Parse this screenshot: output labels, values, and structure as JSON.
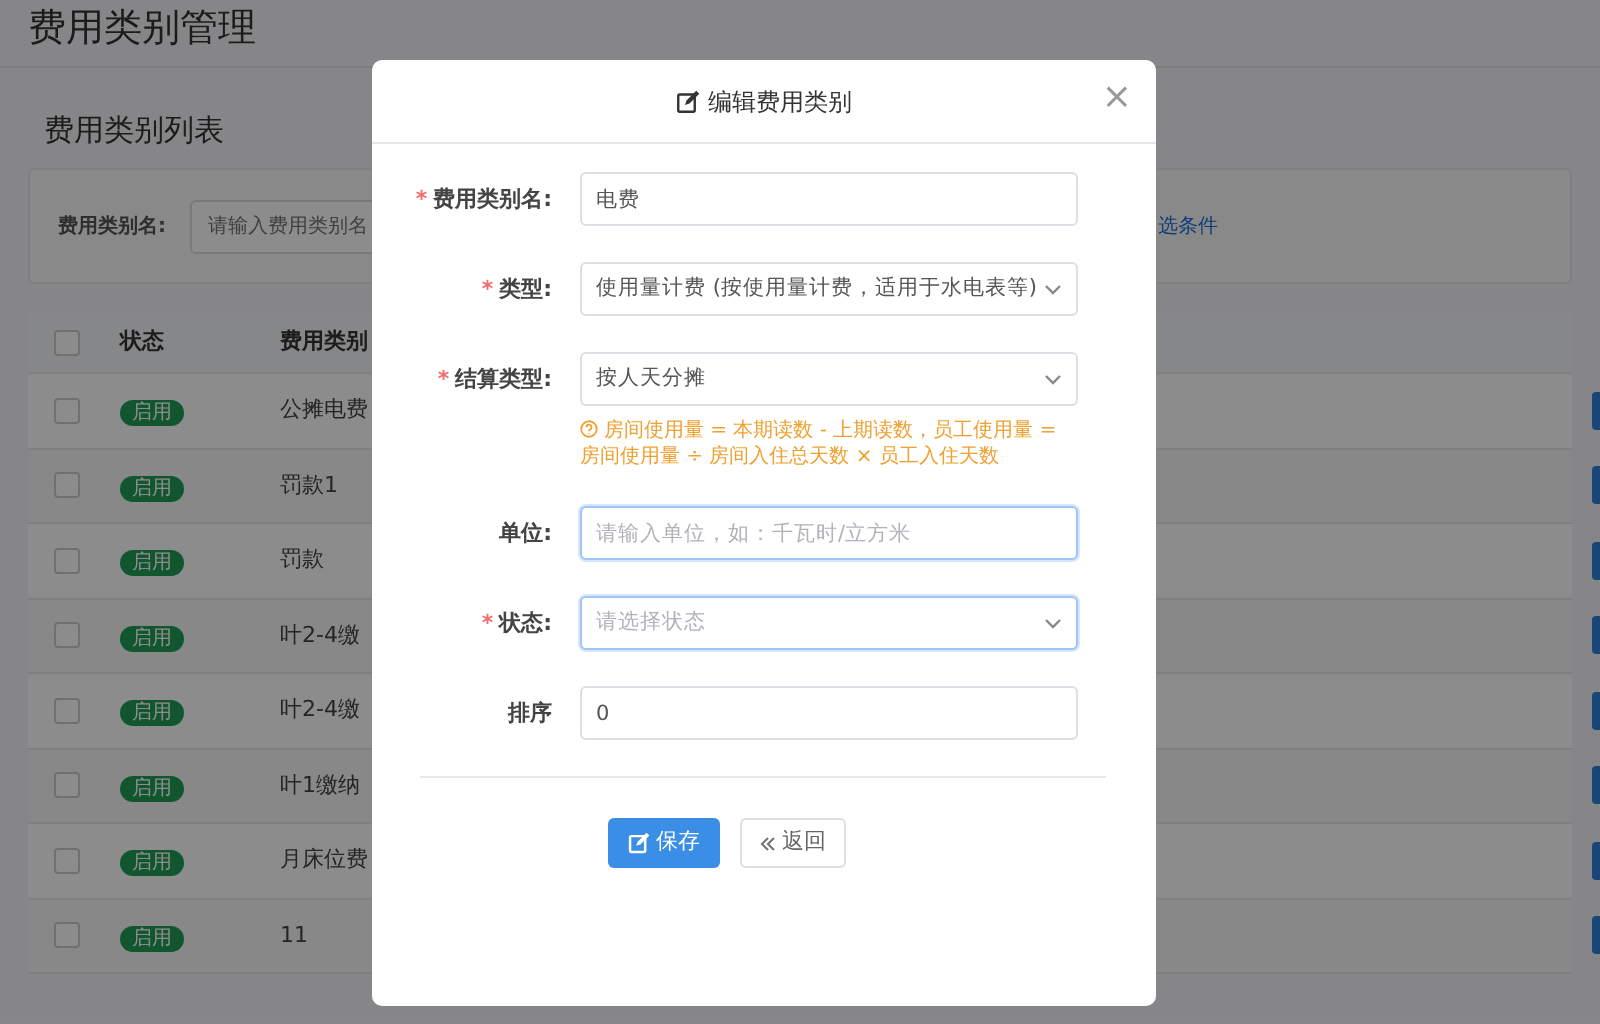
{
  "page": {
    "title": "费用类别管理",
    "section_title": "费用类别列表"
  },
  "filter": {
    "label": "费用类别名:",
    "placeholder": "请输入费用类别名",
    "link": "选条件"
  },
  "table": {
    "columns": [
      "状态",
      "费用类别"
    ],
    "select_all_checked": false,
    "rows": [
      {
        "checked": false,
        "status": "启用",
        "name": "公摊电费"
      },
      {
        "checked": false,
        "status": "启用",
        "name": "罚款1"
      },
      {
        "checked": false,
        "status": "启用",
        "name": "罚款"
      },
      {
        "checked": false,
        "status": "启用",
        "name": "叶2-4缴"
      },
      {
        "checked": false,
        "status": "启用",
        "name": "叶2-4缴"
      },
      {
        "checked": false,
        "status": "启用",
        "name": "叶1缴纳"
      },
      {
        "checked": false,
        "status": "启用",
        "name": "月床位费"
      },
      {
        "checked": false,
        "status": "启用",
        "name": "11"
      }
    ]
  },
  "dialog": {
    "title": "编辑费用类别",
    "close": "×",
    "fields": [
      {
        "kind": "text",
        "label": "费用类别名:",
        "required_mark": "*",
        "value": "电费",
        "focused": false
      },
      {
        "kind": "select",
        "label": "类型:",
        "required_mark": "*",
        "value": "使用量计费 (按使用量计费，适用于水电表等)",
        "focused": false
      },
      {
        "kind": "select",
        "label": "结算类型:",
        "required_mark": "*",
        "value": "按人天分摊",
        "focused": false,
        "hint": "房间使用量 = 本期读数 - 上期读数，员工使用量 = 房间使用量 ÷ 房间入住总天数 × 员工入住天数"
      },
      {
        "kind": "text",
        "label": "单位:",
        "placeholder": "请输入单位，如：千瓦时/立方米",
        "focused": true
      },
      {
        "kind": "select",
        "label": "状态:",
        "required_mark": "*",
        "placeholder": "请选择状态",
        "focused": true
      },
      {
        "kind": "text",
        "label": "排序",
        "value": "0",
        "focused": false
      }
    ],
    "buttons": [
      {
        "kind": "primary",
        "label": "保存"
      },
      {
        "kind": "back",
        "label": "返回"
      }
    ]
  }
}
